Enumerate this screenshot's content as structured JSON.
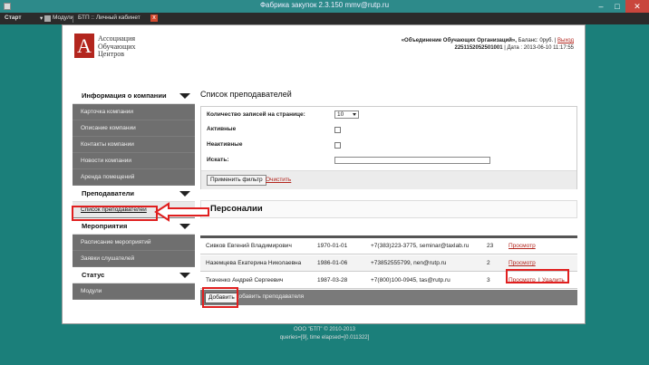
{
  "window": {
    "title": "Фабрика закупок 2.3.150 mmv@rutp.ru"
  },
  "toolbar": {
    "start": "Старт",
    "modules": "Модули",
    "tab": "БТП :: Личный кабинет",
    "close": "x"
  },
  "header": {
    "logo_letter": "А",
    "logo_line1": "Ассоциация",
    "logo_line2": "Обучающих",
    "logo_line3": "Центров",
    "org": "«Объединение Обучающих Организаций»,",
    "balance": " Баланс: 0руб. |",
    "logout": "Выход",
    "id": "2251152052501001",
    "date": " | Дата : 2013-06-10 11:17:55"
  },
  "sidebar": {
    "sections": [
      {
        "title": "Информация о компании",
        "items": [
          "Карточка компании",
          "Описание компании",
          "Контакты компании",
          "Новости компании",
          "Аренда помещений"
        ]
      },
      {
        "title": "Преподаватели",
        "items": [
          "Список преподавателей"
        ]
      },
      {
        "title": "Мероприятия",
        "items": [
          "Расписание мероприятий",
          "Заявки слушателей"
        ]
      },
      {
        "title": "Статус",
        "items": [
          "Модули"
        ]
      }
    ]
  },
  "main": {
    "title": "Список преподавателей",
    "filter": {
      "per_page_label": "Количество записей на странице:",
      "per_page_value": "10",
      "active_label": "Активные",
      "inactive_label": "Неактивные",
      "search_label": "Искать:",
      "apply": "Применить фильтр",
      "reset": "Очистить"
    },
    "section": "Персоналии",
    "rows": [
      {
        "name": "Сивков Евгений Владимирович",
        "date": "1970-01-01",
        "contact": "+7(383)223-3775, seminar@taxlab.ru",
        "n": "23",
        "view": "Просмотр",
        "del": ""
      },
      {
        "name": "Наземцева Екатерина Николаевна",
        "date": "1986-01-06",
        "contact": "+73852555799, nen@rutp.ru",
        "n": "2",
        "view": "Просмотр",
        "del": ""
      },
      {
        "name": "Ткаченко Андрей Сергеевич",
        "date": "1987-03-28",
        "contact": "+7(800)100-0945, tas@rutp.ru",
        "n": "3",
        "view": "Просмотр",
        "del": "Удалить"
      }
    ],
    "add_button": "Добавить",
    "add_text": "Добавить преподавателя"
  },
  "footer": {
    "line1": "ООО \"БТП\" © 2010-2013",
    "line2": "queries=[9], time elapsed=[0.011322]"
  },
  "colors": {
    "brand": "#b3261e",
    "annotation": "#e01f1f",
    "desktop": "#1b7f7a"
  }
}
